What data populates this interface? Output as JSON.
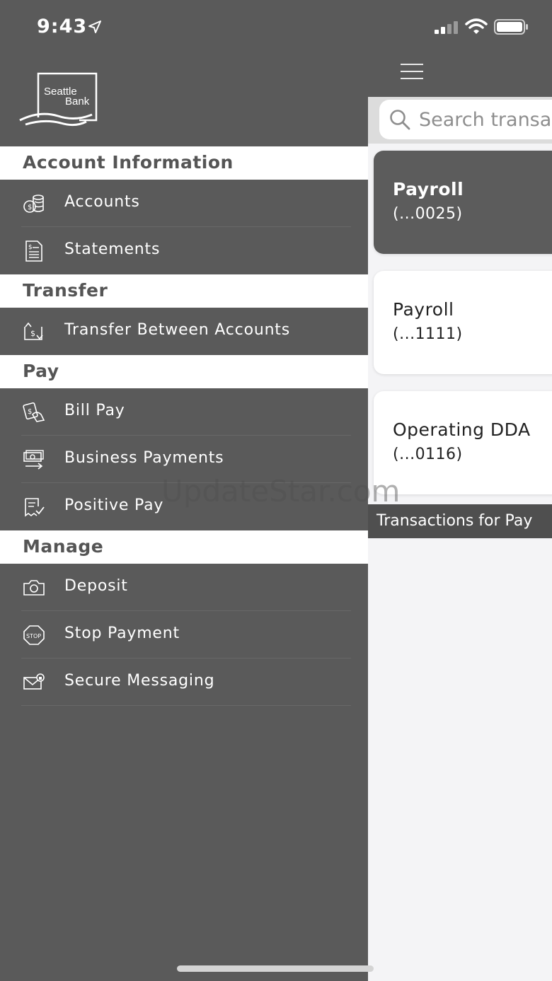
{
  "status_bar": {
    "time": "9:43"
  },
  "brand": {
    "logo_line1": "Seattle",
    "logo_line2": "Bank"
  },
  "menu": {
    "sections": [
      {
        "title": "Account Information",
        "items": [
          {
            "label": "Accounts",
            "icon": "coins-icon"
          },
          {
            "label": "Statements",
            "icon": "document-icon"
          }
        ]
      },
      {
        "title": "Transfer",
        "items": [
          {
            "label": "Transfer Between Accounts",
            "icon": "transfer-icon"
          }
        ]
      },
      {
        "title": "Pay",
        "items": [
          {
            "label": "Bill Pay",
            "icon": "bill-pay-icon"
          },
          {
            "label": "Business Payments",
            "icon": "business-payments-icon"
          },
          {
            "label": "Positive Pay",
            "icon": "positive-pay-icon"
          }
        ]
      },
      {
        "title": "Manage",
        "items": [
          {
            "label": "Deposit",
            "icon": "camera-icon"
          },
          {
            "label": "Stop Payment",
            "icon": "stop-icon"
          },
          {
            "label": "Secure Messaging",
            "icon": "envelope-icon"
          }
        ]
      }
    ]
  },
  "main": {
    "search_placeholder": "Search transa",
    "accounts": [
      {
        "name": "Payroll",
        "number": "(...0025)",
        "selected": true
      },
      {
        "name": "Payroll",
        "number": "(...1111)",
        "selected": false
      },
      {
        "name": "Operating DDA",
        "number": "(...0116)",
        "selected": false
      }
    ],
    "transactions_header": "Transactions for Pay"
  },
  "watermark": "UpdateStar.com"
}
